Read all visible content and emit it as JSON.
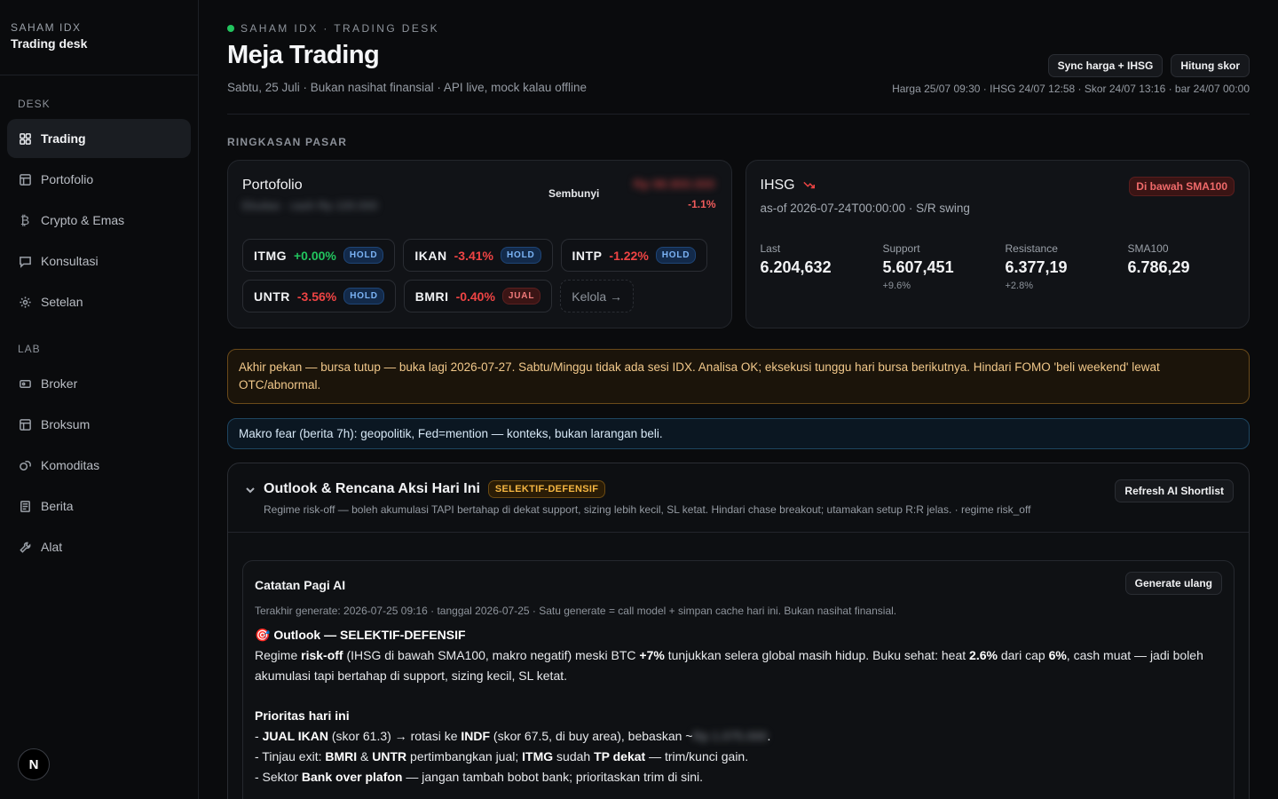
{
  "sidebar": {
    "brand_small": "SAHAM IDX",
    "brand_big": "Trading desk",
    "section_desk": "DESK",
    "section_lab": "LAB",
    "desk_items": [
      {
        "label": "Trading",
        "icon": "grid-icon",
        "active": true
      },
      {
        "label": "Portofolio",
        "icon": "table-icon"
      },
      {
        "label": "Crypto & Emas",
        "icon": "bitcoin-icon"
      },
      {
        "label": "Konsultasi",
        "icon": "chat-icon"
      },
      {
        "label": "Setelan",
        "icon": "gear-icon"
      }
    ],
    "lab_items": [
      {
        "label": "Broker",
        "icon": "card-icon"
      },
      {
        "label": "Broksum",
        "icon": "table-icon"
      },
      {
        "label": "Komoditas",
        "icon": "coins-icon"
      },
      {
        "label": "Berita",
        "icon": "newspaper-icon"
      },
      {
        "label": "Alat",
        "icon": "wrench-icon"
      }
    ],
    "badge": "N"
  },
  "header": {
    "kicker": "SAHAM IDX · TRADING DESK",
    "title": "Meja Trading",
    "subtitle": "Sabtu, 25 Juli · Bukan nasihat finansial · API live, mock kalau offline",
    "btn_sync": "Sync harga + IHSG",
    "btn_score": "Hitung skor",
    "timestamps": "Harga 25/07 09:30 · IHSG 24/07 12:58 · Skor 24/07 13:16 · bar 24/07 00:00"
  },
  "market": {
    "section_label": "RINGKASAN PASAR",
    "portfolio": {
      "title": "Portofolio",
      "subtitle_hidden": "Ekuitas · cash Rp 100.000",
      "hide_label": "Sembunyi",
      "value_hidden": "Rp 98.900.000",
      "change_pct": "-1.1%",
      "holdings": [
        {
          "ticker": "ITMG",
          "change": "+0.00%",
          "direction": "up",
          "action": "HOLD"
        },
        {
          "ticker": "IKAN",
          "change": "-3.41%",
          "direction": "down",
          "action": "HOLD"
        },
        {
          "ticker": "INTP",
          "change": "-1.22%",
          "direction": "down",
          "action": "HOLD"
        },
        {
          "ticker": "UNTR",
          "change": "-3.56%",
          "direction": "down",
          "action": "HOLD"
        },
        {
          "ticker": "BMRI",
          "change": "-0.40%",
          "direction": "down",
          "action": "JUAL"
        }
      ],
      "manage_label": "Kelola →"
    },
    "ihsg": {
      "title": "IHSG",
      "badge": "Di bawah SMA100",
      "subtitle": "as-of 2026-07-24T00:00:00 · S/R swing",
      "stats": [
        {
          "label": "Last",
          "value": "6.204,632",
          "sub": ""
        },
        {
          "label": "Support",
          "value": "5.607,451",
          "sub": "+9.6%"
        },
        {
          "label": "Resistance",
          "value": "6.377,19",
          "sub": "+2.8%"
        },
        {
          "label": "SMA100",
          "value": "6.786,29",
          "sub": ""
        }
      ]
    }
  },
  "alerts": {
    "weekend": "Akhir pekan — bursa tutup — buka lagi 2026-07-27. Sabtu/Minggu tidak ada sesi IDX. Analisa OK; eksekusi tunggu hari bursa berikutnya. Hindari FOMO 'beli weekend' lewat OTC/abnormal.",
    "macro": "Makro fear (berita 7h): geopolitik, Fed=mention — konteks, bukan larangan beli."
  },
  "outlook": {
    "title": "Outlook & Rencana Aksi Hari Ini",
    "badge": "SELEKTIF-DEFENSIF",
    "subtitle": "Regime risk-off — boleh akumulasi TAPI bertahap di dekat support, sizing lebih kecil, SL ketat. Hindari chase breakout; utamakan setup R:R jelas. · regime risk_off",
    "refresh_label": "Refresh AI Shortlist",
    "note": {
      "title": "Catatan Pagi AI",
      "regen_label": "Generate ulang",
      "meta": "Terakhir generate: 2026-07-25 09:16 · tanggal 2026-07-25 · Satu generate = call model + simpan cache hari ini. Bukan nasihat finansial.",
      "heading_icon": "🎯",
      "heading": "Outlook — SELEKTIF-DEFENSIF",
      "para_1": "Regime",
      "para_2": "risk-off",
      "para_3": "(IHSG di bawah SMA100, makro negatif) meski BTC",
      "para_4": "+7%",
      "para_5": "tunjukkan selera global masih hidup. Buku sehat: heat",
      "para_6": "2.6%",
      "para_7": "dari cap",
      "para_8": "6%",
      "para_9": ", cash muat — jadi boleh akumulasi tapi bertahap di support, sizing kecil, SL ketat.",
      "priority_title": "Prioritas hari ini",
      "p1_a": "- ",
      "p1_b": "JUAL IKAN",
      "p1_c": " (skor 61.3) → rotasi ke ",
      "p1_d": "INDF",
      "p1_e": " (skor 67.5, di buy area), bebaskan ~",
      "p1_hidden": "Rp 1.075.000",
      "p1_f": ".",
      "p2_a": "- Tinjau exit: ",
      "p2_b": "BMRI",
      "p2_c": " & ",
      "p2_d": "UNTR",
      "p2_e": " pertimbangkan jual; ",
      "p2_f": "ITMG",
      "p2_g": " sudah ",
      "p2_h": "TP dekat",
      "p2_i": " — trim/kunci gain.",
      "p3_a": "- Sektor ",
      "p3_b": "Bank over plafon",
      "p3_c": " — jangan tambah bobot bank; prioritaskan trim di sini."
    }
  }
}
